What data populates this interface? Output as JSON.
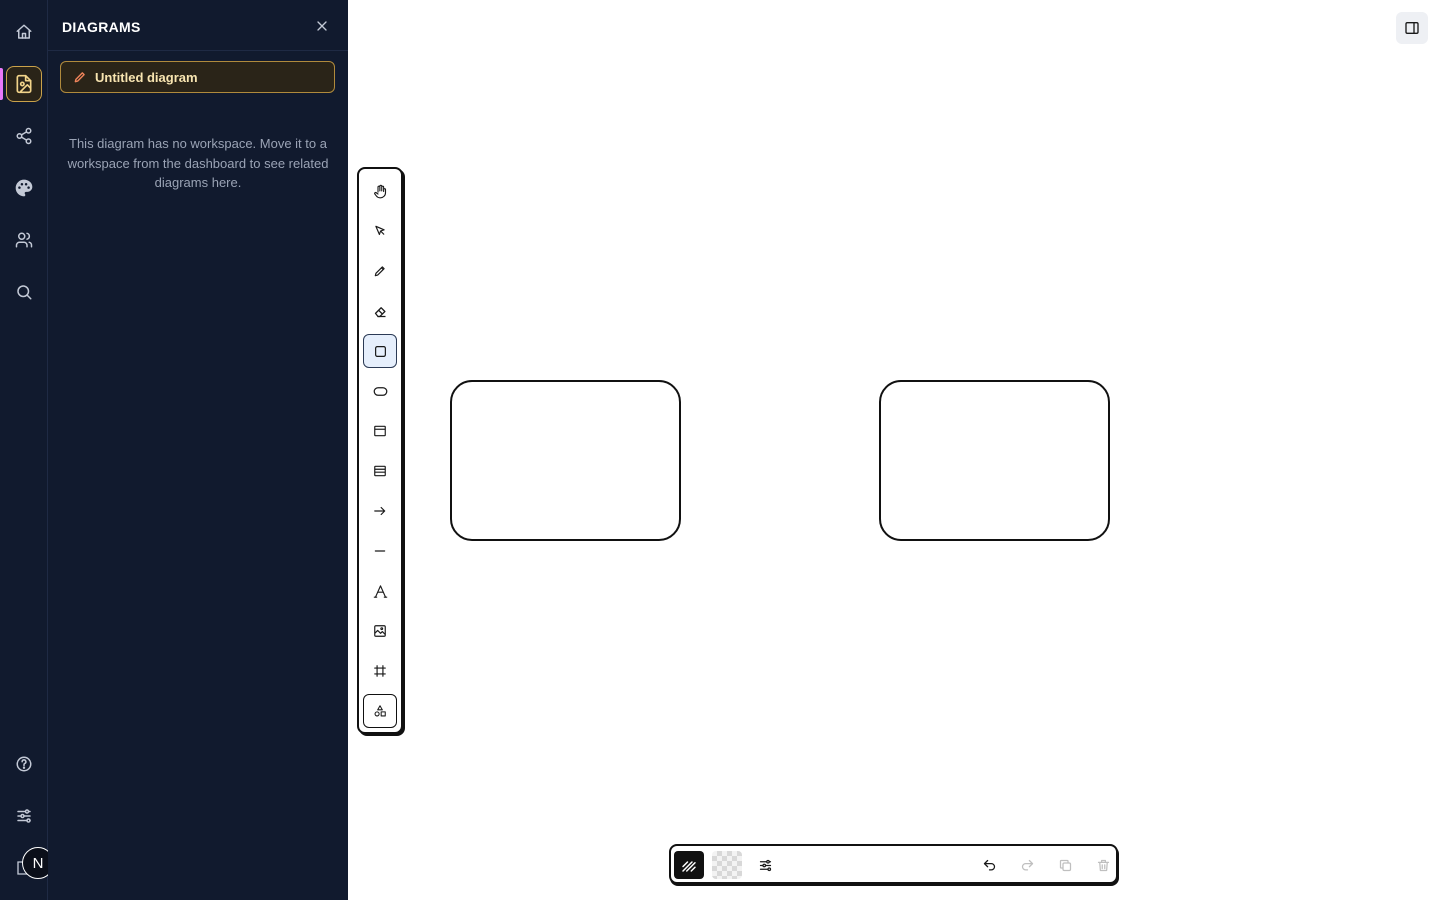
{
  "panel": {
    "title": "DIAGRAMS",
    "active_diagram": "Untitled diagram",
    "note": "This diagram has no workspace. Move it to a workspace from the dashboard to see related diagrams here."
  },
  "rail": {
    "items": [
      "home-icon",
      "diagram-icon",
      "share-icon",
      "palette-icon",
      "users-icon",
      "search-icon"
    ],
    "bottom_items": [
      "help-icon",
      "settings-sliders-icon"
    ],
    "avatar_letter": "N"
  },
  "toolbar": {
    "tools": [
      "hand",
      "select",
      "pencil",
      "eraser",
      "rectangle",
      "ellipse",
      "frame",
      "table",
      "arrow",
      "line",
      "text",
      "image",
      "grid",
      "shapes"
    ],
    "active_tool": "rectangle"
  },
  "bottom_toolbar": {
    "items": [
      "stroke-style",
      "fill-transparent",
      "style-settings",
      "undo",
      "redo",
      "duplicate",
      "delete"
    ]
  },
  "colors": {
    "sidebar_bg": "#111a2e",
    "accent": "#caa24a",
    "indicator": "#e879f9"
  }
}
